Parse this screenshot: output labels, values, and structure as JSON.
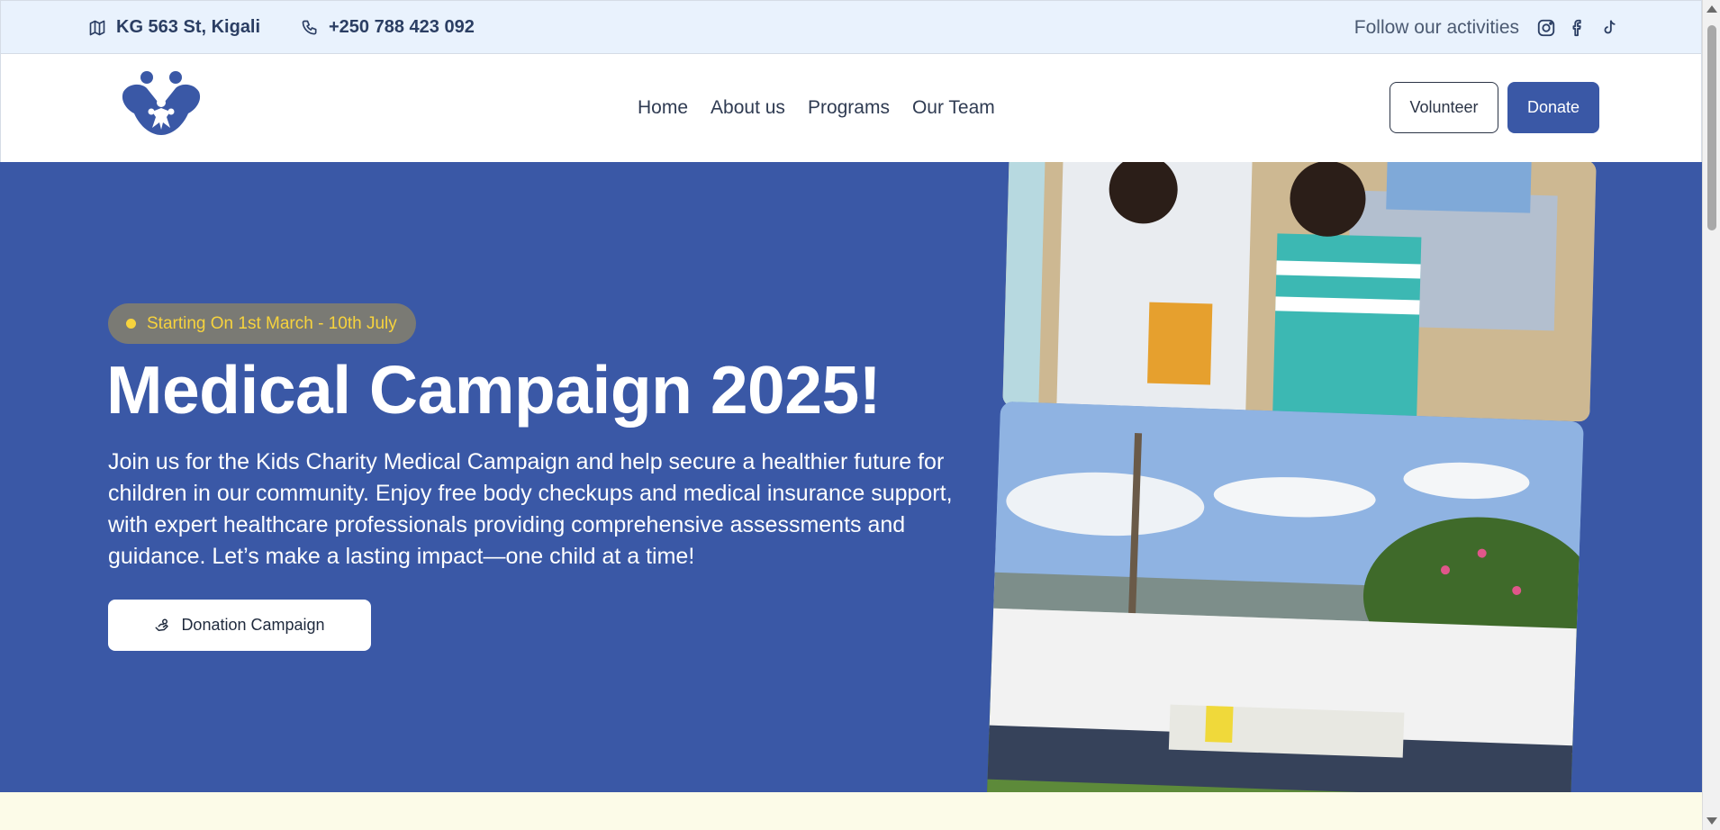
{
  "topbar": {
    "address": "KG 563 St, Kigali",
    "phone": "+250 788 423 092",
    "follow_text": "Follow our activities",
    "social_icons": [
      "instagram-icon",
      "facebook-icon",
      "tiktok-icon"
    ]
  },
  "navbar": {
    "nav_items": [
      "Home",
      "About us",
      "Programs",
      "Our Team"
    ],
    "volunteer_label": "Volunteer",
    "donate_label": "Donate"
  },
  "hero": {
    "badge_text": "Starting On 1st March - 10th July",
    "title": "Medical Campaign 2025!",
    "description": "Join us for the Kids Charity Medical Campaign and help secure a healthier future for children in our community. Enjoy free body checkups and medical insurance support, with expert healthcare professionals providing comprehensive assessments and guidance. Let’s make a lasting impact—one child at a time!",
    "cta_label": "Donation Campaign",
    "cta_icon": "hand-coins-icon"
  },
  "colors": {
    "primary": "#3a58a6",
    "topbar_bg": "#e9f2fd",
    "badge_bg": "#7a7a74",
    "badge_text": "#f7d33d",
    "strip_bg": "#fcfbe8"
  }
}
